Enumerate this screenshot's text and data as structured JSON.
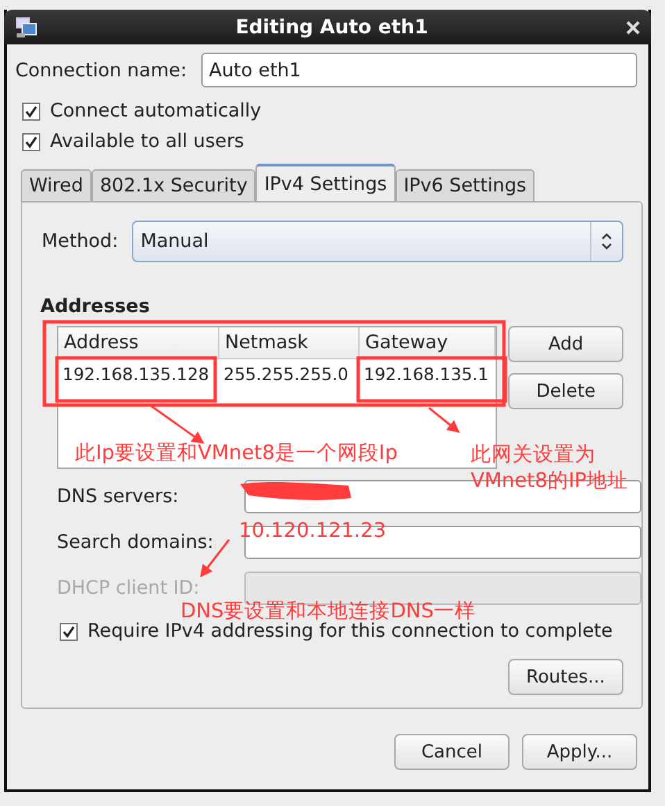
{
  "window": {
    "title": "Editing Auto eth1"
  },
  "connection_name": {
    "label": "Connection name:",
    "value": "Auto eth1"
  },
  "options": [
    {
      "label": "Connect automatically",
      "checked": true
    },
    {
      "label": "Available to all users",
      "checked": true
    }
  ],
  "tabs": [
    {
      "label": "Wired",
      "selected": false
    },
    {
      "label": "802.1x Security",
      "selected": false
    },
    {
      "label": "IPv4 Settings",
      "selected": true
    },
    {
      "label": "IPv6 Settings",
      "selected": false
    }
  ],
  "method": {
    "label": "Method:",
    "value": "Manual"
  },
  "addresses": {
    "title": "Addresses",
    "columns": [
      "Address",
      "Netmask",
      "Gateway"
    ],
    "rows": [
      [
        "192.168.135.128",
        "255.255.255.0",
        "192.168.135.1"
      ]
    ],
    "buttons": [
      "Add",
      "Delete"
    ]
  },
  "fields": [
    {
      "label": "DNS servers:",
      "disabled": false,
      "redacted": true
    },
    {
      "label": "Search domains:",
      "disabled": false,
      "redacted": false
    },
    {
      "label": "DHCP client ID:",
      "disabled": true,
      "redacted": false
    }
  ],
  "require": {
    "label": "Require IPv4 addressing for this connection to complete",
    "checked": true
  },
  "routes_button": "Routes...",
  "buttons": [
    "Cancel",
    "Apply..."
  ],
  "annotations": [
    {
      "kind": "text",
      "text": "此Ip要设置和VMnet8是一个网段Ip"
    },
    {
      "kind": "text",
      "text": "此网关设置为"
    },
    {
      "kind": "text",
      "text": "VMnet8的IP地址"
    },
    {
      "kind": "text",
      "text": "10.120.121.23"
    },
    {
      "kind": "text",
      "text": "DNS要设置和本地连接DNS一样"
    }
  ]
}
